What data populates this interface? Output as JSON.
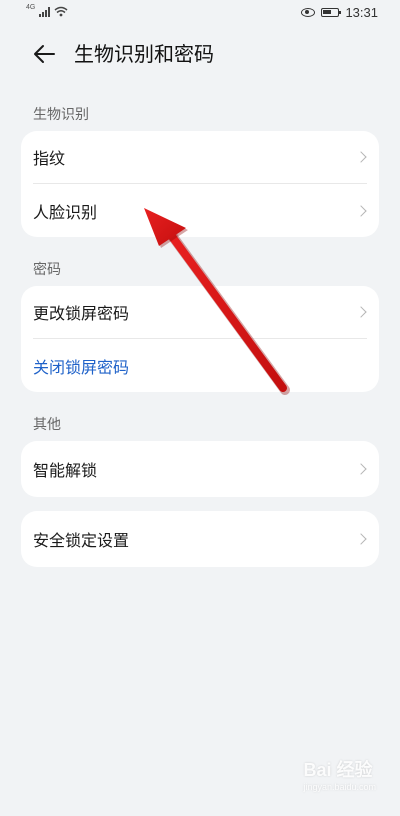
{
  "status_bar": {
    "network": "4G",
    "time": "13:31"
  },
  "header": {
    "title": "生物识别和密码"
  },
  "sections": {
    "biometrics": {
      "label": "生物识别",
      "items": [
        "指纹",
        "人脸识别"
      ]
    },
    "password": {
      "label": "密码",
      "items": [
        "更改锁屏密码",
        "关闭锁屏密码"
      ]
    },
    "other": {
      "label": "其他",
      "items": [
        "智能解锁"
      ]
    },
    "security_lock": {
      "items": [
        "安全锁定设置"
      ]
    }
  },
  "colors": {
    "link": "#1f62c9",
    "arrow": "#e01a1a",
    "background": "#f1f3f5"
  },
  "watermark": {
    "brand": "Bai 经验",
    "url": "jingyan.baidu.com"
  }
}
